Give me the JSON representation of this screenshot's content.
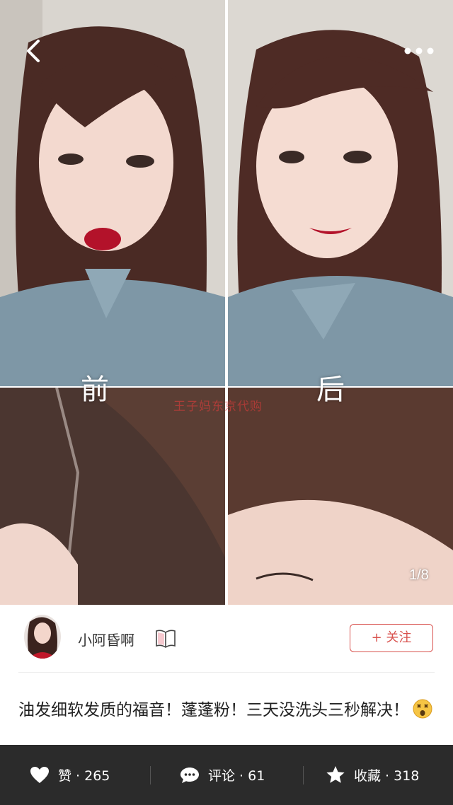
{
  "hero": {
    "label_before": "前",
    "label_after": "后",
    "watermark": "王子妈东京代购",
    "counter": "1/8"
  },
  "author": {
    "name": "小阿昏啊",
    "follow_label": "+ 关注"
  },
  "post": {
    "title": "油发细软发质的福音！蓬蓬粉！三天没洗头三秒解决！"
  },
  "bottom_bar": {
    "like_label": "赞 · 265",
    "comment_label": "评论 · 61",
    "favorite_label": "收藏 · 318"
  },
  "icons": {
    "back": "chevron-left-icon",
    "more": "more-dots-icon",
    "like": "heart-icon",
    "comment": "speech-bubble-icon",
    "favorite": "star-icon",
    "badge": "open-book-icon",
    "emoji": "dizzy-face-emoji"
  },
  "colors": {
    "accent": "#d9534f",
    "bottom_bar_bg": "#2b2b2b"
  }
}
